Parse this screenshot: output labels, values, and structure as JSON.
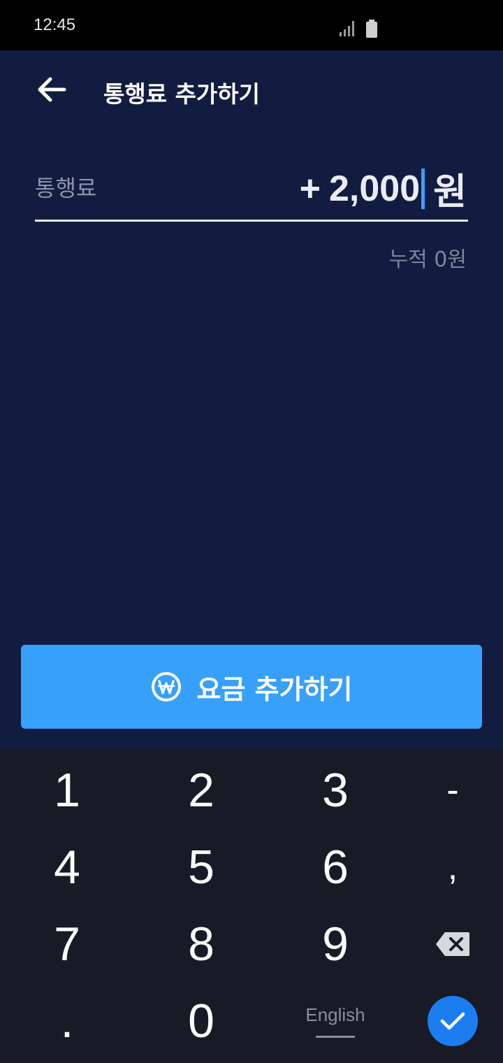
{
  "status_bar": {
    "time": "12:45",
    "icons": [
      "signal-icon",
      "battery-icon"
    ]
  },
  "header": {
    "back_icon": "arrow-left-icon",
    "title": "통행료 추가하기"
  },
  "toll": {
    "label": "통행료",
    "prefix": "+",
    "amount": "2,000",
    "unit": "원",
    "accumulated": "누적 0원"
  },
  "add_button": {
    "icon": "won-icon",
    "label": "요금 추가하기"
  },
  "keypad": {
    "keys": [
      "1",
      "2",
      "3",
      "-",
      "4",
      "5",
      "6",
      ",",
      "7",
      "8",
      "9",
      "backspace-icon",
      ".",
      "0",
      "English",
      "check-icon"
    ],
    "language_label": "English"
  },
  "colors": {
    "background": "#111c40",
    "accent": "#36a0fb",
    "keypad_background": "#181a26",
    "confirm": "#1a7ef0"
  }
}
